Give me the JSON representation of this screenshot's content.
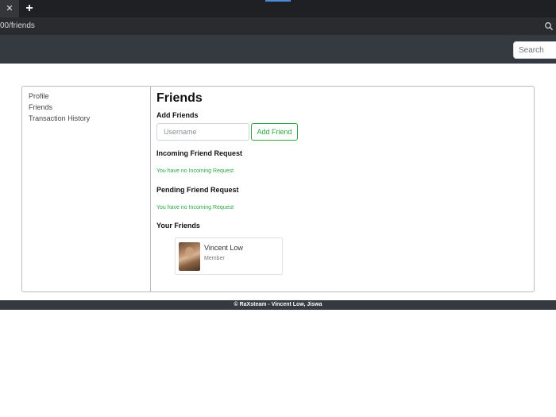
{
  "browser": {
    "close_glyph": "✕",
    "new_tab_glyph": "+",
    "url": "00/friends",
    "zoom_icon": "magnifier-icon"
  },
  "navbar": {
    "search_placeholder": "Search"
  },
  "sidebar": {
    "items": [
      {
        "label": "Profile"
      },
      {
        "label": "Friends"
      },
      {
        "label": "Transaction History"
      }
    ]
  },
  "main": {
    "title": "Friends",
    "add_friends": {
      "heading": "Add Friends",
      "username_placeholder": "Username",
      "button_label": "Add Friend"
    },
    "incoming": {
      "heading": "Incoming Friend Request",
      "empty_message": "You have no Incoming Request"
    },
    "pending": {
      "heading": "Pending Friend Request",
      "empty_message": "You have no Incoming Request"
    },
    "your_friends": {
      "heading": "Your Friends",
      "friends": [
        {
          "name": "Vincent Low",
          "role": "Member"
        }
      ]
    }
  },
  "footer": {
    "text": "© RaXsteam - Vincent Low, Jiswa"
  },
  "colors": {
    "navbar_bg": "#343a40",
    "accent_green": "#28a745",
    "tab_accent": "#4b8bd8"
  }
}
